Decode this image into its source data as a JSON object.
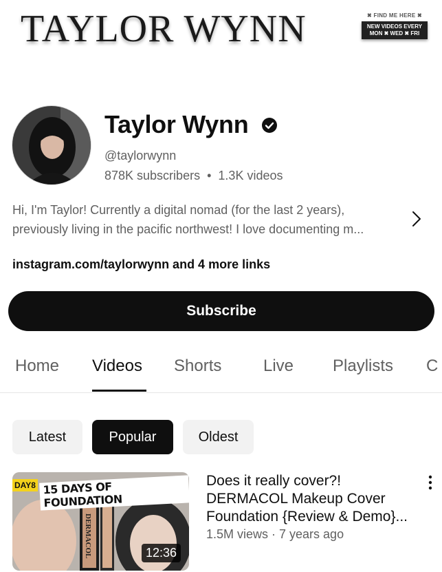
{
  "banner": {
    "title": "TAYLOR WYNN",
    "find_me": "✖ FIND ME HERE ✖",
    "schedule_line1": "NEW VIDEOS EVERY",
    "schedule_line2": "MON ✖ WED ✖ FRI"
  },
  "channel": {
    "name": "Taylor Wynn",
    "handle": "@taylorwynn",
    "subscribers": "878K subscribers",
    "separator": "•",
    "videos": "1.3K videos",
    "description_line1": "Hi, I'm Taylor! Currently a digital nomad (for the last 2 years),",
    "description_line2": "previously living in the pacific northwest! I love documenting m...",
    "links": "instagram.com/taylorwynn and 4 more links"
  },
  "subscribe_label": "Subscribe",
  "tabs": [
    {
      "label": "Home"
    },
    {
      "label": "Videos"
    },
    {
      "label": "Shorts"
    },
    {
      "label": "Live"
    },
    {
      "label": "Playlists"
    },
    {
      "label": "C"
    }
  ],
  "active_tab": "Videos",
  "chips": [
    {
      "label": "Latest"
    },
    {
      "label": "Popular"
    },
    {
      "label": "Oldest"
    }
  ],
  "active_chip": "Popular",
  "video": {
    "title_line1": "Does it really cover?!",
    "title_line2": "DERMACOL Makeup Cover",
    "title_line3": "Foundation {Review & Demo}...",
    "meta": "1.5M views · 7 years ago",
    "duration": "12:36",
    "thumb_day_badge": "DAY8",
    "thumb_series_text": "15 DAYS OF FOUNDATION",
    "thumb_product_text": "DERMACOL"
  },
  "colors": {
    "text_primary": "#0f0f0f",
    "text_secondary": "#606060",
    "chip_bg": "#f2f2f2",
    "button_bg": "#0f0f0f"
  }
}
